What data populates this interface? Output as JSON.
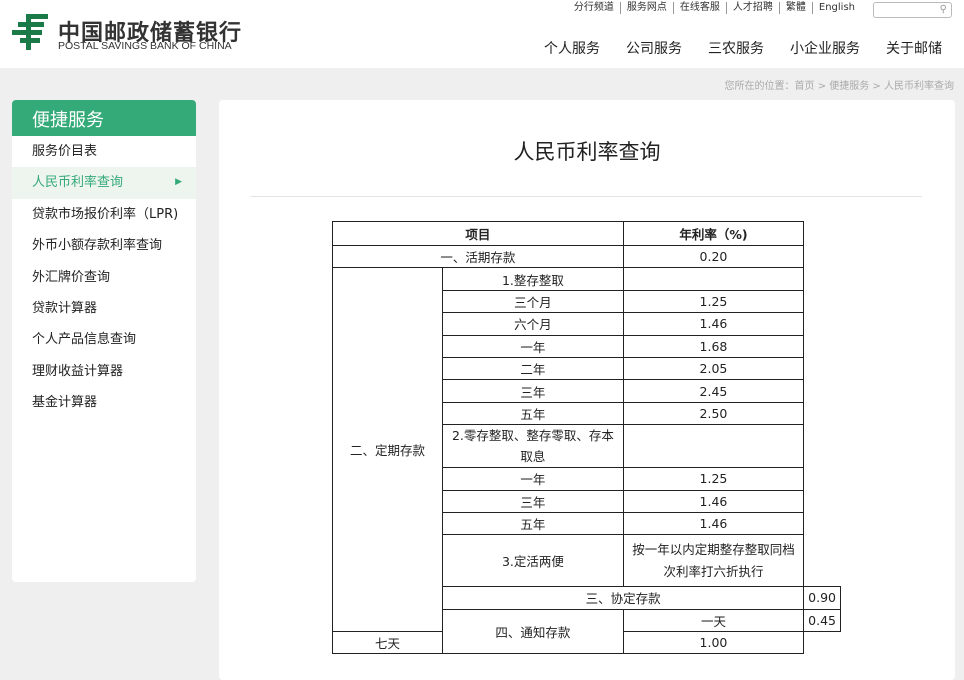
{
  "header": {
    "logo_cn": "中国邮政储蓄银行",
    "logo_en": "POSTAL SAVINGS BANK OF CHINA",
    "top_links": [
      "分行频道",
      "服务网点",
      "在线客服",
      "人才招聘",
      "繁體",
      "English"
    ],
    "nav": [
      "个人服务",
      "公司服务",
      "三农服务",
      "小企业服务",
      "关于邮储"
    ]
  },
  "breadcrumb": "您所在的位置：首页 > 便捷服务 > 人民币利率查询",
  "sidebar": {
    "title": "便捷服务",
    "items": [
      {
        "label": "服务价目表"
      },
      {
        "label": "人民币利率查询"
      },
      {
        "label": "贷款市场报价利率（LPR)"
      },
      {
        "label": "外币小额存款利率查询"
      },
      {
        "label": "外汇牌价查询"
      },
      {
        "label": "贷款计算器"
      },
      {
        "label": "个人产品信息查询"
      },
      {
        "label": "理财收益计算器"
      },
      {
        "label": "基金计算器"
      }
    ]
  },
  "page": {
    "title": "人民币利率查询"
  },
  "table": {
    "headers": [
      "项目",
      "年利率（%)"
    ],
    "demand": {
      "label": "一、活期存款",
      "rate": "0.20"
    },
    "fixed": {
      "label": "二、定期存款",
      "s1": {
        "label": "1.整存整取",
        "rows": [
          {
            "term": "三个月",
            "rate": "1.25"
          },
          {
            "term": "六个月",
            "rate": "1.46"
          },
          {
            "term": "一年",
            "rate": "1.68"
          },
          {
            "term": "二年",
            "rate": "2.05"
          },
          {
            "term": "三年",
            "rate": "2.45"
          },
          {
            "term": "五年",
            "rate": "2.50"
          }
        ]
      },
      "s2": {
        "label": "2.零存整取、整存零取、存本取息",
        "rows": [
          {
            "term": "一年",
            "rate": "1.25"
          },
          {
            "term": "三年",
            "rate": "1.46"
          },
          {
            "term": "五年",
            "rate": "1.46"
          }
        ]
      },
      "s3": {
        "label": "3.定活两便",
        "rate": "按一年以内定期整存整取同档次利率打六折执行"
      }
    },
    "agreement": {
      "label": "三、协定存款",
      "rate": "0.90"
    },
    "notice": {
      "label": "四、通知存款",
      "rows": [
        {
          "term": "一天",
          "rate": "0.45"
        },
        {
          "term": "七天",
          "rate": "1.00"
        }
      ]
    }
  }
}
